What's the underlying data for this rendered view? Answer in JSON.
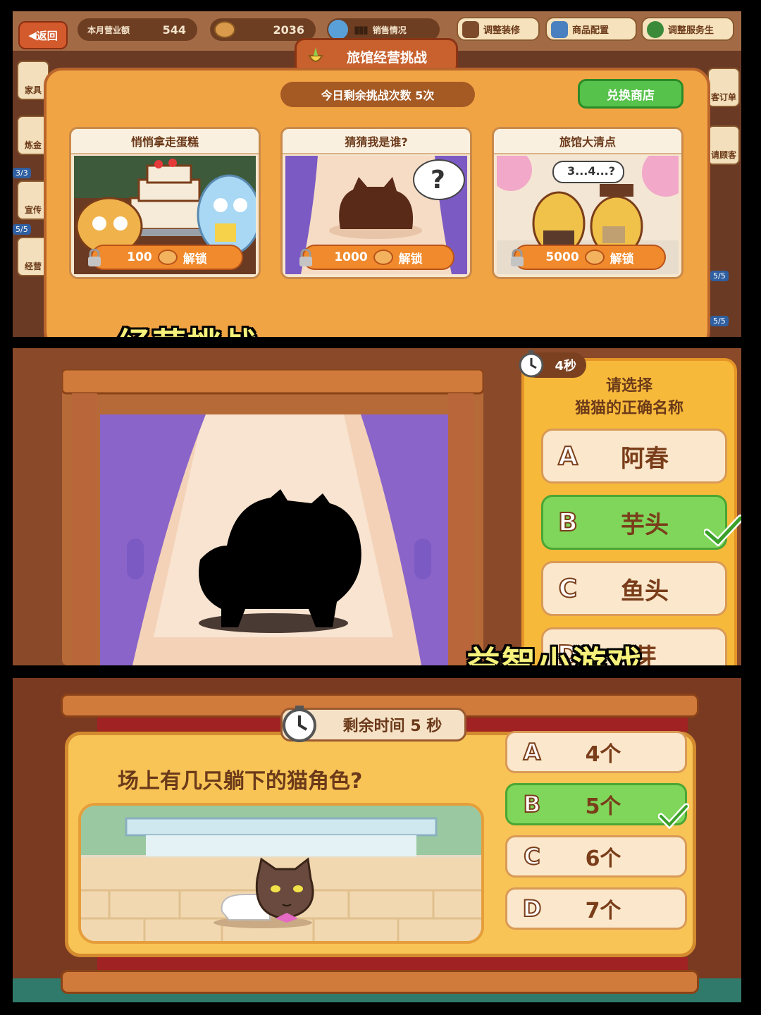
{
  "colors": {
    "accent_orange": "#f1a444",
    "correct_green": "#7fd65a",
    "caption_yellow": "#f6f17a",
    "text_brown": "#6b3a1a"
  },
  "panel1": {
    "topbar": {
      "back_label": "返回",
      "monthly_revenue_label": "本月营业额",
      "monthly_revenue_value": "544",
      "coins_value": "2036",
      "sales_label": "销售情况",
      "tools": [
        "调整装修",
        "商品配置",
        "调整服务生"
      ]
    },
    "side_left": [
      "家具",
      "炼金",
      "宣传",
      "经营"
    ],
    "side_left_counts": [
      "3/3",
      "5/5"
    ],
    "side_right": [
      "客订单",
      "请顾客"
    ],
    "side_right_counts": [
      "5/5",
      "5/5"
    ],
    "dialog": {
      "title": "旅馆经营挑战",
      "remaining": "今日剩余挑战次数 5次",
      "shop_button": "兑换商店",
      "cards": [
        {
          "title": "悄悄拿走蛋糕",
          "cost": "100",
          "unlock": "解锁"
        },
        {
          "title": "猜猜我是谁?",
          "cost": "1000",
          "unlock": "解锁"
        },
        {
          "title": "旅馆大清点",
          "cost": "5000",
          "unlock": "解锁",
          "bubble": "3...4...?"
        }
      ]
    },
    "caption": "经营挑战"
  },
  "panel2": {
    "timer": "4秒",
    "question_line1": "请选择",
    "question_line2": "猫猫的正确名称",
    "bubble": "?",
    "options": [
      {
        "letter": "A",
        "name": "阿春",
        "correct": false
      },
      {
        "letter": "B",
        "name": "芋头",
        "correct": true
      },
      {
        "letter": "C",
        "name": "鱼头",
        "correct": false
      },
      {
        "letter": "D",
        "name": "芽",
        "correct": false
      }
    ],
    "caption": "益智小游戏"
  },
  "panel3": {
    "timer": "剩余时间 5 秒",
    "question": "场上有几只躺下的猫角色?",
    "options": [
      {
        "letter": "A",
        "name": "4个",
        "correct": false
      },
      {
        "letter": "B",
        "name": "5个",
        "correct": true
      },
      {
        "letter": "C",
        "name": "6个",
        "correct": false
      },
      {
        "letter": "D",
        "name": "7个",
        "correct": false
      }
    ]
  }
}
